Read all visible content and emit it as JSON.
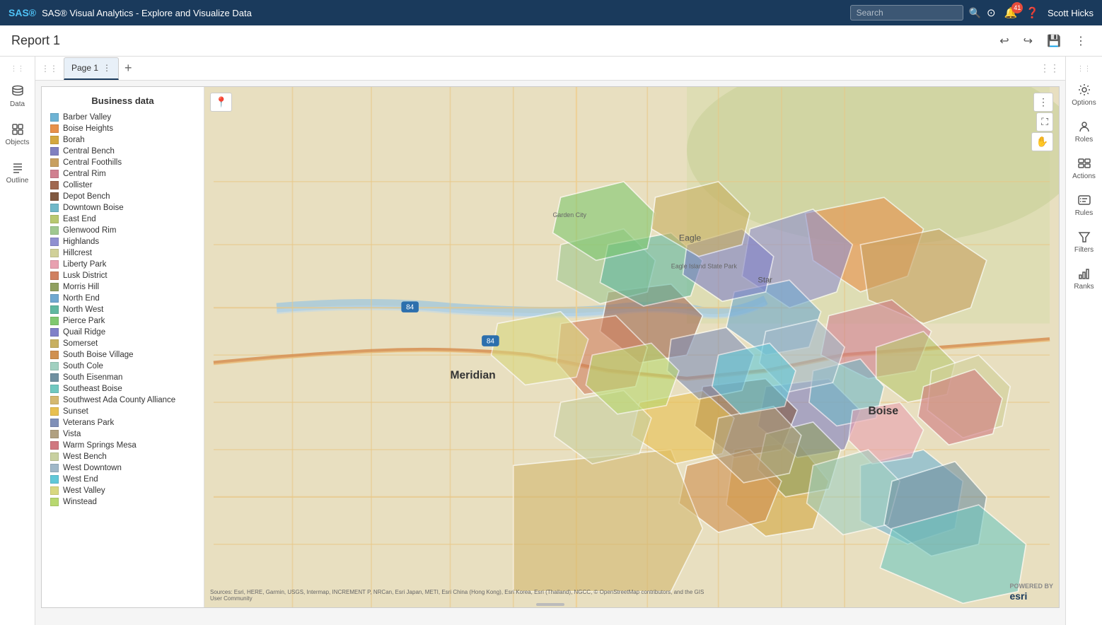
{
  "app": {
    "title": "SAS® Visual Analytics - Explore and Visualize Data",
    "search_placeholder": "Search"
  },
  "topbar": {
    "notification_count": "41",
    "user_name": "Scott Hicks"
  },
  "report": {
    "title": "Report 1"
  },
  "tabs": [
    {
      "label": "Page 1",
      "active": true
    }
  ],
  "add_tab_label": "+",
  "left_sidebar": [
    {
      "id": "data",
      "label": "Data",
      "icon": "database"
    },
    {
      "id": "objects",
      "label": "Objects",
      "icon": "objects"
    },
    {
      "id": "outline",
      "label": "Outline",
      "icon": "outline"
    }
  ],
  "right_sidebar": [
    {
      "id": "options",
      "label": "Options",
      "icon": "options"
    },
    {
      "id": "roles",
      "label": "Roles",
      "icon": "roles"
    },
    {
      "id": "actions",
      "label": "Actions",
      "icon": "actions"
    },
    {
      "id": "rules",
      "label": "Rules",
      "icon": "rules"
    },
    {
      "id": "filters",
      "label": "Filters",
      "icon": "filters"
    },
    {
      "id": "ranks",
      "label": "Ranks",
      "icon": "ranks"
    }
  ],
  "legend": {
    "title": "Business data",
    "items": [
      {
        "label": "Barber Valley",
        "color": "#6eb3d4"
      },
      {
        "label": "Boise Heights",
        "color": "#e8904a"
      },
      {
        "label": "Borah",
        "color": "#d4a840"
      },
      {
        "label": "Central Bench",
        "color": "#8080c0"
      },
      {
        "label": "Central Foothills",
        "color": "#c8a060"
      },
      {
        "label": "Central Rim",
        "color": "#d08090"
      },
      {
        "label": "Collister",
        "color": "#a06850"
      },
      {
        "label": "Depot Bench",
        "color": "#805840"
      },
      {
        "label": "Downtown Boise",
        "color": "#70b8c8"
      },
      {
        "label": "East End",
        "color": "#b8c870"
      },
      {
        "label": "Glenwood Rim",
        "color": "#a0c890"
      },
      {
        "label": "Highlands",
        "color": "#9090d0"
      },
      {
        "label": "Hillcrest",
        "color": "#d0d098"
      },
      {
        "label": "Liberty Park",
        "color": "#e8a0b0"
      },
      {
        "label": "Lusk District",
        "color": "#d08060"
      },
      {
        "label": "Morris Hill",
        "color": "#90a060"
      },
      {
        "label": "North End",
        "color": "#70a8d0"
      },
      {
        "label": "North West",
        "color": "#60b8a0"
      },
      {
        "label": "Pierce Park",
        "color": "#80c870"
      },
      {
        "label": "Quail Ridge",
        "color": "#8080c8"
      },
      {
        "label": "Somerset",
        "color": "#c8b060"
      },
      {
        "label": "South Boise Village",
        "color": "#d09050"
      },
      {
        "label": "South Cole",
        "color": "#a0d0c0"
      },
      {
        "label": "South Eisenman",
        "color": "#7090a0"
      },
      {
        "label": "Southeast Boise",
        "color": "#70c8c0"
      },
      {
        "label": "Southwest Ada County Alliance",
        "color": "#d4b870"
      },
      {
        "label": "Sunset",
        "color": "#e8c050"
      },
      {
        "label": "Veterans Park",
        "color": "#8090b8"
      },
      {
        "label": "Vista",
        "color": "#b0a080"
      },
      {
        "label": "Warm Springs Mesa",
        "color": "#d07880"
      },
      {
        "label": "West Bench",
        "color": "#c8d0a0"
      },
      {
        "label": "West Downtown",
        "color": "#a0b8c8"
      },
      {
        "label": "West End",
        "color": "#60c8d8"
      },
      {
        "label": "West Valley",
        "color": "#d8d880"
      },
      {
        "label": "Winstead",
        "color": "#b8d870"
      }
    ]
  },
  "map": {
    "pin_btn": "📍",
    "more_btn": "⋮",
    "expand_btn": "⛶",
    "pan_btn": "✋",
    "attribution": "Sources: Esri, HERE, Garmin, USGS, Intermap, INCREMENT P, NRCan, Esri Japan, METI, Esri China (Hong Kong), Esri Korea, Esri (Thailand), NGCC, © OpenStreetMap contributors, and the GIS User Community",
    "powered_by": "esri"
  }
}
